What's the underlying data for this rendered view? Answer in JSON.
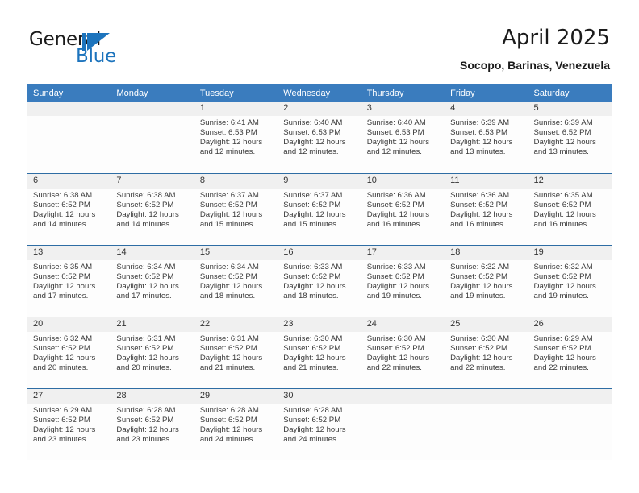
{
  "branding": {
    "logo_text_primary": "General",
    "logo_text_secondary": "Blue",
    "logo_mark": "triangle-flag-icon",
    "accent_color": "#1d74bd"
  },
  "header": {
    "title": "April 2025",
    "location": "Socopo, Barinas, Venezuela",
    "header_bg_color": "#3a7cbe",
    "header_text_color": "#ffffff"
  },
  "weekdays": [
    "Sunday",
    "Monday",
    "Tuesday",
    "Wednesday",
    "Thursday",
    "Friday",
    "Saturday"
  ],
  "weeks": [
    [
      {
        "day": "",
        "sunrise": "",
        "sunset": "",
        "daylight_line1": "",
        "daylight_line2": "",
        "empty": true
      },
      {
        "day": "",
        "sunrise": "",
        "sunset": "",
        "daylight_line1": "",
        "daylight_line2": "",
        "empty": true
      },
      {
        "day": "1",
        "sunrise": "Sunrise: 6:41 AM",
        "sunset": "Sunset: 6:53 PM",
        "daylight_line1": "Daylight: 12 hours",
        "daylight_line2": "and 12 minutes.",
        "empty": false
      },
      {
        "day": "2",
        "sunrise": "Sunrise: 6:40 AM",
        "sunset": "Sunset: 6:53 PM",
        "daylight_line1": "Daylight: 12 hours",
        "daylight_line2": "and 12 minutes.",
        "empty": false
      },
      {
        "day": "3",
        "sunrise": "Sunrise: 6:40 AM",
        "sunset": "Sunset: 6:53 PM",
        "daylight_line1": "Daylight: 12 hours",
        "daylight_line2": "and 12 minutes.",
        "empty": false
      },
      {
        "day": "4",
        "sunrise": "Sunrise: 6:39 AM",
        "sunset": "Sunset: 6:53 PM",
        "daylight_line1": "Daylight: 12 hours",
        "daylight_line2": "and 13 minutes.",
        "empty": false
      },
      {
        "day": "5",
        "sunrise": "Sunrise: 6:39 AM",
        "sunset": "Sunset: 6:52 PM",
        "daylight_line1": "Daylight: 12 hours",
        "daylight_line2": "and 13 minutes.",
        "empty": false
      }
    ],
    [
      {
        "day": "6",
        "sunrise": "Sunrise: 6:38 AM",
        "sunset": "Sunset: 6:52 PM",
        "daylight_line1": "Daylight: 12 hours",
        "daylight_line2": "and 14 minutes.",
        "empty": false
      },
      {
        "day": "7",
        "sunrise": "Sunrise: 6:38 AM",
        "sunset": "Sunset: 6:52 PM",
        "daylight_line1": "Daylight: 12 hours",
        "daylight_line2": "and 14 minutes.",
        "empty": false
      },
      {
        "day": "8",
        "sunrise": "Sunrise: 6:37 AM",
        "sunset": "Sunset: 6:52 PM",
        "daylight_line1": "Daylight: 12 hours",
        "daylight_line2": "and 15 minutes.",
        "empty": false
      },
      {
        "day": "9",
        "sunrise": "Sunrise: 6:37 AM",
        "sunset": "Sunset: 6:52 PM",
        "daylight_line1": "Daylight: 12 hours",
        "daylight_line2": "and 15 minutes.",
        "empty": false
      },
      {
        "day": "10",
        "sunrise": "Sunrise: 6:36 AM",
        "sunset": "Sunset: 6:52 PM",
        "daylight_line1": "Daylight: 12 hours",
        "daylight_line2": "and 16 minutes.",
        "empty": false
      },
      {
        "day": "11",
        "sunrise": "Sunrise: 6:36 AM",
        "sunset": "Sunset: 6:52 PM",
        "daylight_line1": "Daylight: 12 hours",
        "daylight_line2": "and 16 minutes.",
        "empty": false
      },
      {
        "day": "12",
        "sunrise": "Sunrise: 6:35 AM",
        "sunset": "Sunset: 6:52 PM",
        "daylight_line1": "Daylight: 12 hours",
        "daylight_line2": "and 16 minutes.",
        "empty": false
      }
    ],
    [
      {
        "day": "13",
        "sunrise": "Sunrise: 6:35 AM",
        "sunset": "Sunset: 6:52 PM",
        "daylight_line1": "Daylight: 12 hours",
        "daylight_line2": "and 17 minutes.",
        "empty": false
      },
      {
        "day": "14",
        "sunrise": "Sunrise: 6:34 AM",
        "sunset": "Sunset: 6:52 PM",
        "daylight_line1": "Daylight: 12 hours",
        "daylight_line2": "and 17 minutes.",
        "empty": false
      },
      {
        "day": "15",
        "sunrise": "Sunrise: 6:34 AM",
        "sunset": "Sunset: 6:52 PM",
        "daylight_line1": "Daylight: 12 hours",
        "daylight_line2": "and 18 minutes.",
        "empty": false
      },
      {
        "day": "16",
        "sunrise": "Sunrise: 6:33 AM",
        "sunset": "Sunset: 6:52 PM",
        "daylight_line1": "Daylight: 12 hours",
        "daylight_line2": "and 18 minutes.",
        "empty": false
      },
      {
        "day": "17",
        "sunrise": "Sunrise: 6:33 AM",
        "sunset": "Sunset: 6:52 PM",
        "daylight_line1": "Daylight: 12 hours",
        "daylight_line2": "and 19 minutes.",
        "empty": false
      },
      {
        "day": "18",
        "sunrise": "Sunrise: 6:32 AM",
        "sunset": "Sunset: 6:52 PM",
        "daylight_line1": "Daylight: 12 hours",
        "daylight_line2": "and 19 minutes.",
        "empty": false
      },
      {
        "day": "19",
        "sunrise": "Sunrise: 6:32 AM",
        "sunset": "Sunset: 6:52 PM",
        "daylight_line1": "Daylight: 12 hours",
        "daylight_line2": "and 19 minutes.",
        "empty": false
      }
    ],
    [
      {
        "day": "20",
        "sunrise": "Sunrise: 6:32 AM",
        "sunset": "Sunset: 6:52 PM",
        "daylight_line1": "Daylight: 12 hours",
        "daylight_line2": "and 20 minutes.",
        "empty": false
      },
      {
        "day": "21",
        "sunrise": "Sunrise: 6:31 AM",
        "sunset": "Sunset: 6:52 PM",
        "daylight_line1": "Daylight: 12 hours",
        "daylight_line2": "and 20 minutes.",
        "empty": false
      },
      {
        "day": "22",
        "sunrise": "Sunrise: 6:31 AM",
        "sunset": "Sunset: 6:52 PM",
        "daylight_line1": "Daylight: 12 hours",
        "daylight_line2": "and 21 minutes.",
        "empty": false
      },
      {
        "day": "23",
        "sunrise": "Sunrise: 6:30 AM",
        "sunset": "Sunset: 6:52 PM",
        "daylight_line1": "Daylight: 12 hours",
        "daylight_line2": "and 21 minutes.",
        "empty": false
      },
      {
        "day": "24",
        "sunrise": "Sunrise: 6:30 AM",
        "sunset": "Sunset: 6:52 PM",
        "daylight_line1": "Daylight: 12 hours",
        "daylight_line2": "and 22 minutes.",
        "empty": false
      },
      {
        "day": "25",
        "sunrise": "Sunrise: 6:30 AM",
        "sunset": "Sunset: 6:52 PM",
        "daylight_line1": "Daylight: 12 hours",
        "daylight_line2": "and 22 minutes.",
        "empty": false
      },
      {
        "day": "26",
        "sunrise": "Sunrise: 6:29 AM",
        "sunset": "Sunset: 6:52 PM",
        "daylight_line1": "Daylight: 12 hours",
        "daylight_line2": "and 22 minutes.",
        "empty": false
      }
    ],
    [
      {
        "day": "27",
        "sunrise": "Sunrise: 6:29 AM",
        "sunset": "Sunset: 6:52 PM",
        "daylight_line1": "Daylight: 12 hours",
        "daylight_line2": "and 23 minutes.",
        "empty": false
      },
      {
        "day": "28",
        "sunrise": "Sunrise: 6:28 AM",
        "sunset": "Sunset: 6:52 PM",
        "daylight_line1": "Daylight: 12 hours",
        "daylight_line2": "and 23 minutes.",
        "empty": false
      },
      {
        "day": "29",
        "sunrise": "Sunrise: 6:28 AM",
        "sunset": "Sunset: 6:52 PM",
        "daylight_line1": "Daylight: 12 hours",
        "daylight_line2": "and 24 minutes.",
        "empty": false
      },
      {
        "day": "30",
        "sunrise": "Sunrise: 6:28 AM",
        "sunset": "Sunset: 6:52 PM",
        "daylight_line1": "Daylight: 12 hours",
        "daylight_line2": "and 24 minutes.",
        "empty": false
      },
      {
        "day": "",
        "sunrise": "",
        "sunset": "",
        "daylight_line1": "",
        "daylight_line2": "",
        "empty": true
      },
      {
        "day": "",
        "sunrise": "",
        "sunset": "",
        "daylight_line1": "",
        "daylight_line2": "",
        "empty": true
      },
      {
        "day": "",
        "sunrise": "",
        "sunset": "",
        "daylight_line1": "",
        "daylight_line2": "",
        "empty": true
      }
    ]
  ]
}
